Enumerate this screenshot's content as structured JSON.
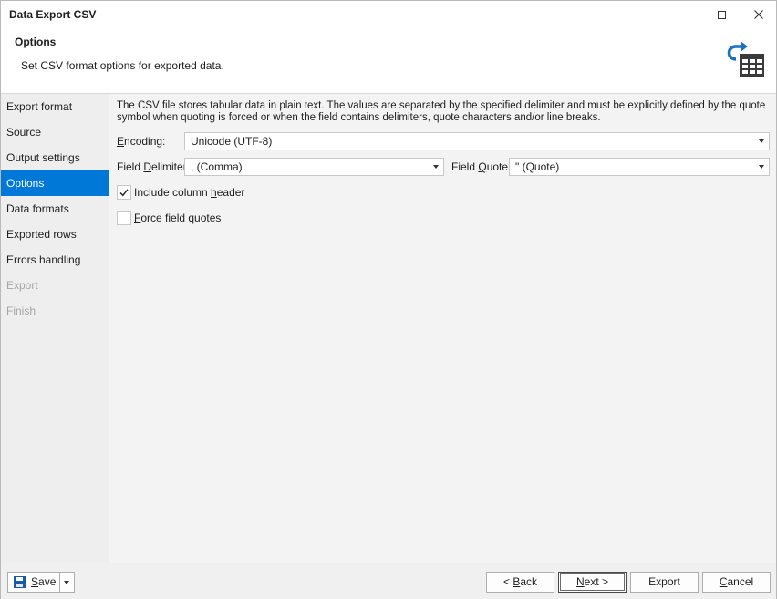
{
  "window": {
    "title": "Data Export CSV",
    "buttons": {
      "minimize": "minimize",
      "maximize": "maximize",
      "close": "close"
    }
  },
  "header": {
    "title": "Options",
    "subtitle": "Set CSV format options for exported data.",
    "icon": "export-table-icon"
  },
  "sidebar": {
    "items": [
      {
        "label": "Export format",
        "state": "normal"
      },
      {
        "label": "Source",
        "state": "normal"
      },
      {
        "label": "Output settings",
        "state": "normal"
      },
      {
        "label": "Options",
        "state": "active"
      },
      {
        "label": "Data formats",
        "state": "normal"
      },
      {
        "label": "Exported rows",
        "state": "normal"
      },
      {
        "label": "Errors handling",
        "state": "normal"
      },
      {
        "label": "Export",
        "state": "disabled"
      },
      {
        "label": "Finish",
        "state": "disabled"
      }
    ]
  },
  "options": {
    "description": "The CSV file stores tabular data in plain text. The values are separated by the specified delimiter and must be explicitly defined by the quote symbol when quoting is forced or when the field contains delimiters, quote characters and/or line breaks.",
    "encoding": {
      "label_u": "E",
      "label_rest": "ncoding:",
      "value": "Unicode (UTF-8)"
    },
    "field_delimiter": {
      "label_pre": "Field ",
      "label_u": "D",
      "label_rest": "elimiter:",
      "value": ", (Comma)"
    },
    "field_quote": {
      "label_pre": "Field ",
      "label_u": "Q",
      "label_rest": "uote:",
      "value": "\" (Quote)"
    },
    "include_header": {
      "label_pre": "Include column ",
      "label_u": "h",
      "label_rest": "eader",
      "checked": true
    },
    "force_quotes": {
      "label_pre": "",
      "label_u": "F",
      "label_rest": "orce field quotes",
      "checked": false
    }
  },
  "footer": {
    "save": {
      "label_u": "S",
      "label_rest": "ave"
    },
    "back": {
      "label_pre": "< ",
      "label_u": "B",
      "label_rest": "ack"
    },
    "next": {
      "label_u": "N",
      "label_rest": "ext >"
    },
    "export": {
      "label": "Export"
    },
    "cancel": {
      "label_u": "C",
      "label_rest": "ancel"
    }
  },
  "colors": {
    "accent": "#0078d7",
    "sidebar_bg": "#eeeeee",
    "content_bg": "#f3f3f3",
    "disabled_text": "#a5a5a5"
  }
}
